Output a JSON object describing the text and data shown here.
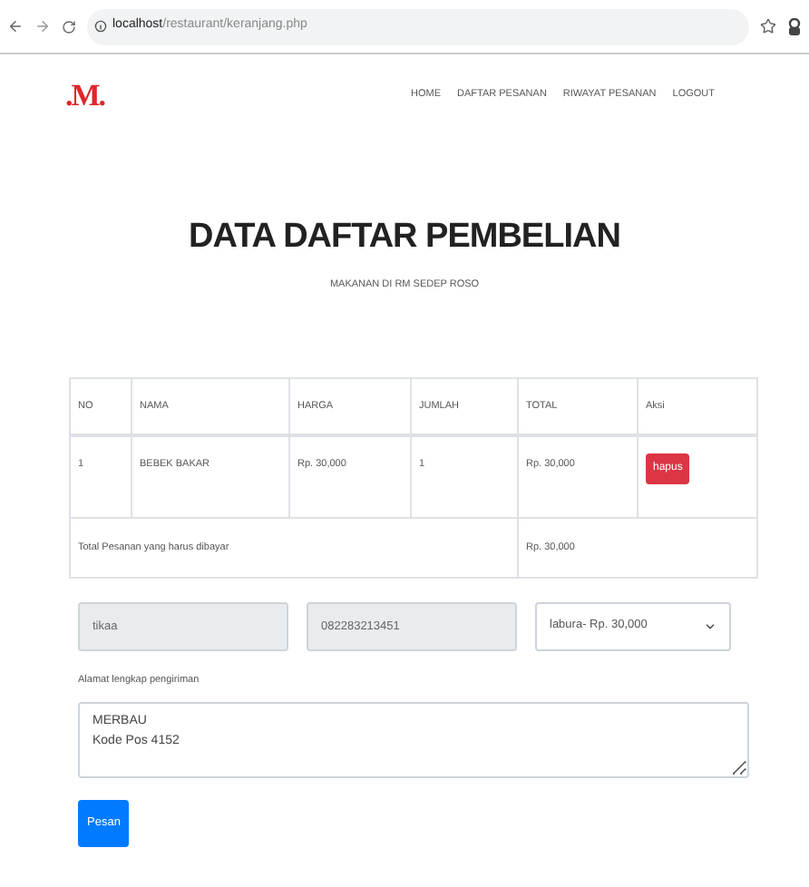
{
  "browser": {
    "url_host": "localhost",
    "url_path": "/restaurant/keranjang.php"
  },
  "logo": ".M.",
  "nav": [
    {
      "label": "HOME"
    },
    {
      "label": "DAFTAR PESANAN"
    },
    {
      "label": "RIWAYAT PESANAN"
    },
    {
      "label": "LOGOUT"
    }
  ],
  "title": "DATA DAFTAR PEMBELIAN",
  "subtitle": "MAKANAN DI RM SEDEP ROSO",
  "table": {
    "columns": [
      "NO",
      "NAMA",
      "HARGA",
      "JUMLAH",
      "TOTAL",
      "Aksi"
    ],
    "rows": [
      {
        "cells": [
          "1",
          "BEBEK BAKAR",
          "Rp. 30,000",
          "1",
          "Rp. 30,000"
        ],
        "action": "hapus"
      }
    ],
    "total_label": "Total Pesanan yang harus dibayar",
    "total_value": "Rp. 30,000"
  },
  "form": {
    "name_value": "tikaa",
    "phone_value": "082283213451",
    "shipping_value": "labura- Rp. 30,000",
    "address_label": "Alamat lengkap pengiriman",
    "address_value": "MERBAU\nKode Pos 4152",
    "submit": "Pesan"
  }
}
